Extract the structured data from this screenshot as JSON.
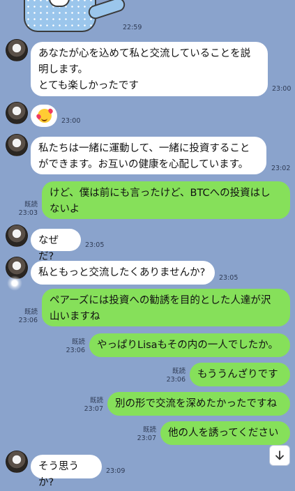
{
  "colors": {
    "background": "#8aa3cc",
    "incoming_bubble": "#ffffff",
    "outgoing_bubble": "#86e05a"
  },
  "icons": {
    "scroll_down": "arrow-down-icon",
    "emoji_sticker": "smiling-face-with-hearts-icon"
  },
  "messages": [
    {
      "direction": "in",
      "type": "sticker",
      "time": "22:59"
    },
    {
      "direction": "in",
      "type": "text",
      "text": "あなたが心を込めて私と交流していることを説\n明します。\nとても楽しかったです",
      "time": "23:00"
    },
    {
      "direction": "in",
      "type": "emoji",
      "time": "23:00"
    },
    {
      "direction": "in",
      "type": "text",
      "text": "私たちは一緒に運動して、一緒に投資すること\nができます。お互いの健康を心配しています。",
      "time": "23:02"
    },
    {
      "direction": "out",
      "type": "text",
      "text": "けど、僕は前にも言ったけど、BTCへの投資はし\nないよ",
      "read": "既読",
      "time": "23:03"
    },
    {
      "direction": "in",
      "type": "text",
      "text": "なぜだ?",
      "time": "23:05"
    },
    {
      "direction": "in",
      "type": "text",
      "text": "私ともっと交流したくありませんか?",
      "time": "23:05"
    },
    {
      "direction": "out",
      "type": "text",
      "text": "ペアーズには投資への勧誘を目的とした人達が沢\n山いますね",
      "read": "既読",
      "time": "23:06"
    },
    {
      "direction": "out",
      "type": "text",
      "text": "やっぱりLisaもその内の一人でしたか。",
      "read": "既読",
      "time": "23:06"
    },
    {
      "direction": "out",
      "type": "text",
      "text": "もううんざりです",
      "read": "既読",
      "time": "23:06"
    },
    {
      "direction": "out",
      "type": "text",
      "text": "別の形で交流を深めたかったですね",
      "read": "既読",
      "time": "23:07"
    },
    {
      "direction": "out",
      "type": "text",
      "text": "他の人を誘ってください",
      "read": "既読",
      "time": "23:07"
    },
    {
      "direction": "in",
      "type": "text",
      "text": "そう思うか?",
      "time": "23:09"
    }
  ]
}
